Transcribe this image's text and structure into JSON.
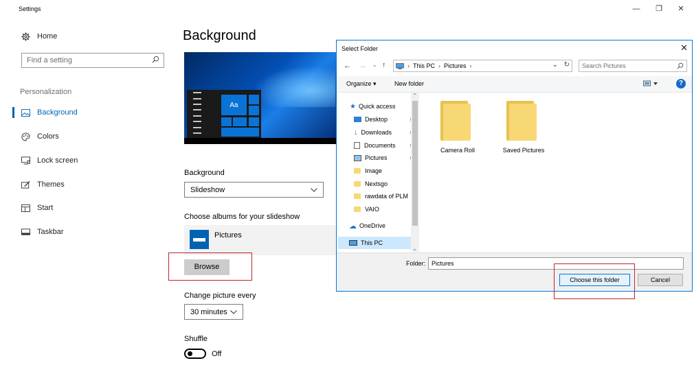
{
  "window": {
    "title": "Settings",
    "minimize": "—",
    "restore": "❐",
    "close": "✕"
  },
  "sidebar": {
    "home": "Home",
    "search_placeholder": "Find a setting",
    "section": "Personalization",
    "items": [
      {
        "label": "Background",
        "icon": "picture-icon",
        "active": true
      },
      {
        "label": "Colors",
        "icon": "palette-icon"
      },
      {
        "label": "Lock screen",
        "icon": "monitor-icon"
      },
      {
        "label": "Themes",
        "icon": "brush-icon"
      },
      {
        "label": "Start",
        "icon": "start-icon"
      },
      {
        "label": "Taskbar",
        "icon": "taskbar-icon"
      }
    ]
  },
  "main": {
    "title": "Background",
    "preview_tile_text": "Aa",
    "background_label": "Background",
    "background_value": "Slideshow",
    "albums_label": "Choose albums for your slideshow",
    "album_name": "Pictures",
    "browse_label": "Browse",
    "change_label": "Change picture every",
    "change_value": "30 minutes",
    "shuffle_label": "Shuffle",
    "shuffle_state": "Off"
  },
  "dialog": {
    "title": "Select Folder",
    "close": "✕",
    "address": [
      "This PC",
      "Pictures"
    ],
    "search_placeholder": "Search Pictures",
    "organize": "Organize ▾",
    "new_folder": "New folder",
    "tree": [
      {
        "label": "Quick access",
        "icon": "star-icon"
      },
      {
        "label": "Desktop",
        "icon": "desktop-icon",
        "pinned": true
      },
      {
        "label": "Downloads",
        "icon": "download-icon",
        "pinned": true
      },
      {
        "label": "Documents",
        "icon": "document-icon",
        "pinned": true
      },
      {
        "label": "Pictures",
        "icon": "pictures-icon",
        "pinned": true
      },
      {
        "label": "Image",
        "icon": "folder-icon"
      },
      {
        "label": "Nextsgo",
        "icon": "folder-icon"
      },
      {
        "label": "rawdata of PLM",
        "icon": "folder-icon"
      },
      {
        "label": "VAIO",
        "icon": "folder-icon"
      },
      {
        "label": "OneDrive",
        "icon": "cloud-icon"
      },
      {
        "label": "This PC",
        "icon": "computer-icon",
        "selected": true
      }
    ],
    "folders": [
      "Camera Roll",
      "Saved Pictures"
    ],
    "folder_label": "Folder:",
    "folder_value": "Pictures",
    "choose_button": "Choose this folder",
    "cancel_button": "Cancel"
  },
  "colors": {
    "accent": "#0063b1",
    "highlight_box": "#c0232c",
    "dialog_border": "#0078d7"
  }
}
